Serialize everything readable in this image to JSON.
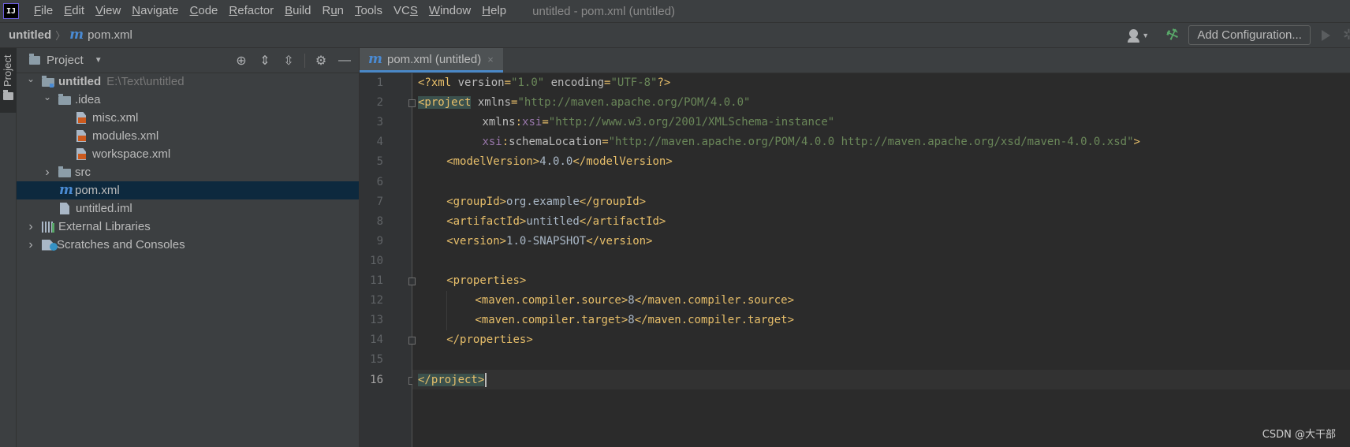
{
  "app": {
    "logo_text": "IJ",
    "window_title": "untitled - pom.xml (untitled)"
  },
  "menu": [
    {
      "pre": "",
      "u": "F",
      "post": "ile"
    },
    {
      "pre": "",
      "u": "E",
      "post": "dit"
    },
    {
      "pre": "",
      "u": "V",
      "post": "iew"
    },
    {
      "pre": "",
      "u": "N",
      "post": "avigate"
    },
    {
      "pre": "",
      "u": "C",
      "post": "ode"
    },
    {
      "pre": "",
      "u": "R",
      "post": "efactor"
    },
    {
      "pre": "",
      "u": "B",
      "post": "uild"
    },
    {
      "pre": "R",
      "u": "u",
      "post": "n"
    },
    {
      "pre": "",
      "u": "T",
      "post": "ools"
    },
    {
      "pre": "VC",
      "u": "S",
      "post": ""
    },
    {
      "pre": "",
      "u": "W",
      "post": "indow"
    },
    {
      "pre": "",
      "u": "H",
      "post": "elp"
    }
  ],
  "navbar": {
    "project": "untitled",
    "separator": "〉",
    "file_icon": "m",
    "file": "pom.xml",
    "add_configuration": "Add Configuration..."
  },
  "toolstrip": {
    "project_label": "Project"
  },
  "project_panel": {
    "title": "Project",
    "tree": [
      {
        "label": "untitled",
        "path": "E:\\Text\\untitled",
        "level": 0,
        "expanded": true,
        "icon": "module-folder-icon",
        "bold": true
      },
      {
        "label": ".idea",
        "level": 1,
        "expanded": true,
        "icon": "folder-icon"
      },
      {
        "label": "misc.xml",
        "level": 2,
        "icon": "xml-file-icon"
      },
      {
        "label": "modules.xml",
        "level": 2,
        "icon": "xml-file-icon"
      },
      {
        "label": "workspace.xml",
        "level": 2,
        "icon": "xml-file-icon"
      },
      {
        "label": "src",
        "level": 1,
        "expanded": false,
        "icon": "folder-icon"
      },
      {
        "label": "pom.xml",
        "level": 1,
        "icon": "maven-file-icon",
        "selected": true
      },
      {
        "label": "untitled.iml",
        "level": 1,
        "icon": "iml-file-icon"
      },
      {
        "label": "External Libraries",
        "level": 0,
        "expanded": false,
        "icon": "libraries-icon"
      },
      {
        "label": "Scratches and Consoles",
        "level": 0,
        "expanded": false,
        "icon": "scratches-icon"
      }
    ]
  },
  "editor": {
    "tab_label": "pom.xml (untitled)",
    "tab_close": "×",
    "current_line": 16,
    "lines": [
      {
        "n": "1",
        "indent": 0,
        "tokens": [
          [
            "t-tag",
            "<?xml "
          ],
          [
            "t-attr",
            "version"
          ],
          [
            "t-tag",
            "="
          ],
          [
            "t-str",
            "\"1.0\""
          ],
          [
            "t-attr",
            " encoding"
          ],
          [
            "t-tag",
            "="
          ],
          [
            "t-str",
            "\"UTF-8\""
          ],
          [
            "t-tag",
            "?>"
          ]
        ]
      },
      {
        "n": "2",
        "indent": 0,
        "tokens": [
          [
            "t-tag t-hl",
            "<project"
          ],
          [
            "t-attr",
            " xmlns"
          ],
          [
            "t-tag",
            "="
          ],
          [
            "t-str",
            "\"http://maven.apache.org/POM/4.0.0\""
          ]
        ]
      },
      {
        "n": "3",
        "indent": 9,
        "tokens": [
          [
            "t-attr",
            "xmlns"
          ],
          [
            "t-tag",
            ":"
          ],
          [
            "t-ns",
            "xsi"
          ],
          [
            "t-tag",
            "="
          ],
          [
            "t-str",
            "\"http://www.w3.org/2001/XMLSchema-instance\""
          ]
        ]
      },
      {
        "n": "4",
        "indent": 9,
        "tokens": [
          [
            "t-ns",
            "xsi"
          ],
          [
            "t-tag",
            ":"
          ],
          [
            "t-attr",
            "schemaLocation"
          ],
          [
            "t-tag",
            "="
          ],
          [
            "t-str",
            "\"http://maven.apache.org/POM/4.0.0 http://maven.apache.org/xsd/maven-4.0.0.xsd\""
          ],
          [
            "t-tag",
            ">"
          ]
        ]
      },
      {
        "n": "5",
        "indent": 4,
        "tokens": [
          [
            "t-tag",
            "<modelVersion>"
          ],
          [
            "t-text",
            "4.0.0"
          ],
          [
            "t-tag",
            "</modelVersion>"
          ]
        ]
      },
      {
        "n": "6",
        "indent": 0,
        "tokens": []
      },
      {
        "n": "7",
        "indent": 4,
        "tokens": [
          [
            "t-tag",
            "<groupId>"
          ],
          [
            "t-text",
            "org.example"
          ],
          [
            "t-tag",
            "</groupId>"
          ]
        ]
      },
      {
        "n": "8",
        "indent": 4,
        "tokens": [
          [
            "t-tag",
            "<artifactId>"
          ],
          [
            "t-text",
            "untitled"
          ],
          [
            "t-tag",
            "</artifactId>"
          ]
        ]
      },
      {
        "n": "9",
        "indent": 4,
        "tokens": [
          [
            "t-tag",
            "<version>"
          ],
          [
            "t-text",
            "1.0-SNAPSHOT"
          ],
          [
            "t-tag",
            "</version>"
          ]
        ]
      },
      {
        "n": "10",
        "indent": 0,
        "tokens": []
      },
      {
        "n": "11",
        "indent": 4,
        "tokens": [
          [
            "t-tag",
            "<properties>"
          ]
        ]
      },
      {
        "n": "12",
        "indent": 8,
        "tokens": [
          [
            "t-tag",
            "<maven.compiler.source>"
          ],
          [
            "t-text",
            "8"
          ],
          [
            "t-tag",
            "</maven.compiler.source>"
          ]
        ]
      },
      {
        "n": "13",
        "indent": 8,
        "tokens": [
          [
            "t-tag",
            "<maven.compiler.target>"
          ],
          [
            "t-text",
            "8"
          ],
          [
            "t-tag",
            "</maven.compiler.target>"
          ]
        ]
      },
      {
        "n": "14",
        "indent": 4,
        "tokens": [
          [
            "t-tag",
            "</properties>"
          ]
        ]
      },
      {
        "n": "15",
        "indent": 0,
        "tokens": []
      },
      {
        "n": "16",
        "indent": 0,
        "tokens": [
          [
            "t-tag t-hl",
            "</project>"
          ]
        ]
      }
    ]
  },
  "watermark": "CSDN @大干部"
}
